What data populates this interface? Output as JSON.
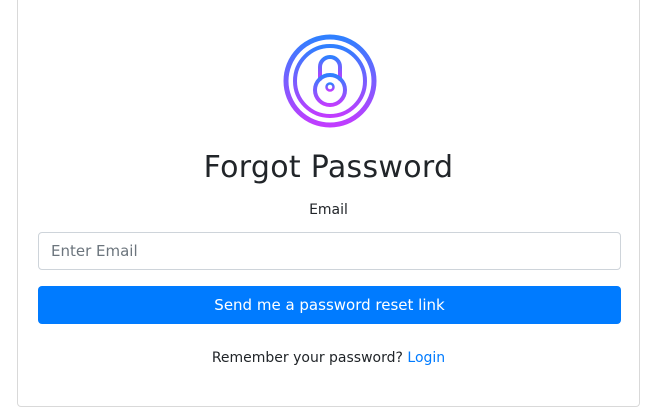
{
  "form": {
    "title": "Forgot Password",
    "email_label": "Email",
    "email_placeholder": "Enter Email",
    "email_value": "",
    "submit_label": "Send me a password reset link",
    "remember_text": "Remember your password?",
    "login_link": "Login"
  },
  "colors": {
    "accent": "#007bff",
    "lock_gradient_start": "#2f80ff",
    "lock_gradient_end": "#c13cff"
  },
  "icons": {
    "lock": "padlock-icon"
  }
}
